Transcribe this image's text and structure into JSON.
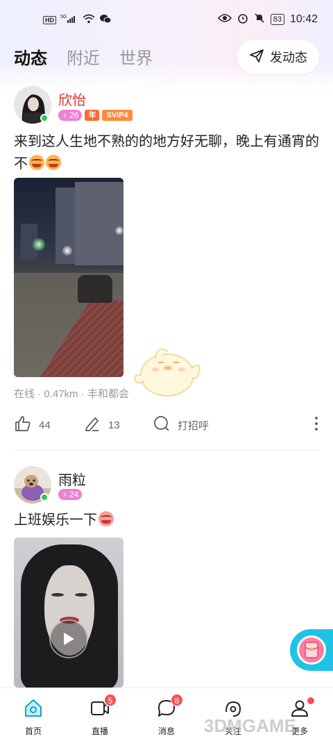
{
  "status_bar": {
    "left_badge": "HD",
    "network": "5G",
    "battery": "83",
    "time": "10:42"
  },
  "header": {
    "tabs": [
      {
        "label": "动态",
        "active": true
      },
      {
        "label": "附近",
        "active": false
      },
      {
        "label": "世界",
        "active": false
      }
    ],
    "post_button": "发动态"
  },
  "posts": [
    {
      "username": "欣怡",
      "age": "26",
      "year_badge": "年",
      "vip_badge": "SVIP4",
      "text": "来到这人生地不熟的的地方好无聊，晚上有通宵的不",
      "meta_status": "在线",
      "meta_distance": "0.47km",
      "meta_location": "丰和都会",
      "likes": "44",
      "comments": "13",
      "greet": "打招呼"
    },
    {
      "username": "雨粒",
      "age": "24",
      "text": "上班娱乐一下"
    }
  ],
  "bottom_nav": [
    {
      "label": "首页",
      "icon": "home-icon",
      "active": true
    },
    {
      "label": "直播",
      "icon": "video-icon",
      "badge": "5"
    },
    {
      "label": "消息",
      "icon": "message-icon",
      "badge": "8"
    },
    {
      "label": "关注",
      "icon": "eye-icon"
    },
    {
      "label": "更多",
      "icon": "user-icon",
      "dot": true
    }
  ],
  "watermark": "3DMGAME",
  "colors": {
    "accent": "#1ec3e6",
    "username_red": "#e0312f",
    "age_badge": "#f07fd5",
    "svip": "#ff8a3c",
    "badge_red": "#ff4d4f"
  }
}
